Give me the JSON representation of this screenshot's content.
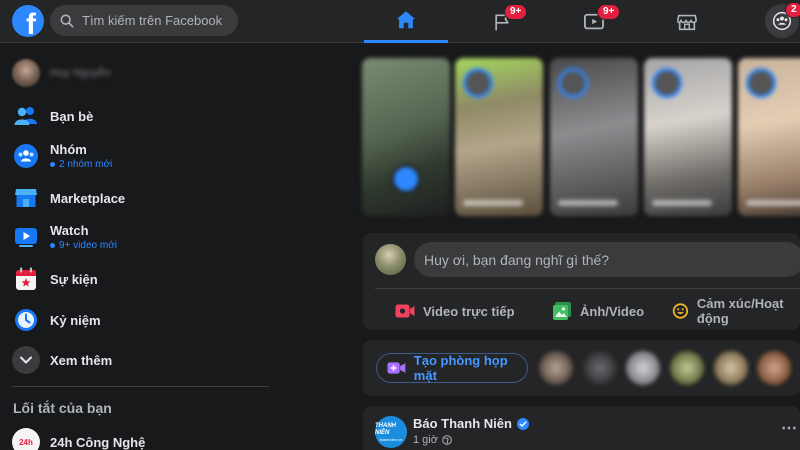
{
  "header": {
    "logo_letter": "f",
    "search_placeholder": "Tìm kiếm trên Facebook",
    "badges": {
      "pages": "9+",
      "watch": "9+",
      "groups": "2"
    }
  },
  "sidebar": {
    "profile_name": "Huy Nguyễn",
    "items": [
      {
        "label": "Bạn bè",
        "sub": ""
      },
      {
        "label": "Nhóm",
        "sub": "2 nhóm mới"
      },
      {
        "label": "Marketplace",
        "sub": ""
      },
      {
        "label": "Watch",
        "sub": "9+ video mới"
      },
      {
        "label": "Sự kiện",
        "sub": ""
      },
      {
        "label": "Kỷ niệm",
        "sub": ""
      },
      {
        "label": "Xem thêm",
        "sub": ""
      }
    ],
    "shortcuts_title": "Lối tắt của bạn",
    "shortcut": {
      "label": "24h Công Nghệ",
      "logo_text": "24h"
    }
  },
  "composer": {
    "placeholder": "Huy ơi, bạn đang nghĩ gì thế?",
    "actions": {
      "live": "Video trực tiếp",
      "photo": "Ảnh/Video",
      "feeling": "Cảm xúc/Hoạt động"
    }
  },
  "rooms": {
    "button_label": "Tạo phòng họp mặt"
  },
  "post": {
    "page_name": "Báo Thanh Niên",
    "time": "1 giờ",
    "logo_line1": "THANH NIÊN",
    "logo_line2": "thanhnien.vn"
  },
  "colors": {
    "accent": "#2d88ff",
    "badge": "#e41e3f",
    "background": "#18191a",
    "surface": "#242526"
  }
}
